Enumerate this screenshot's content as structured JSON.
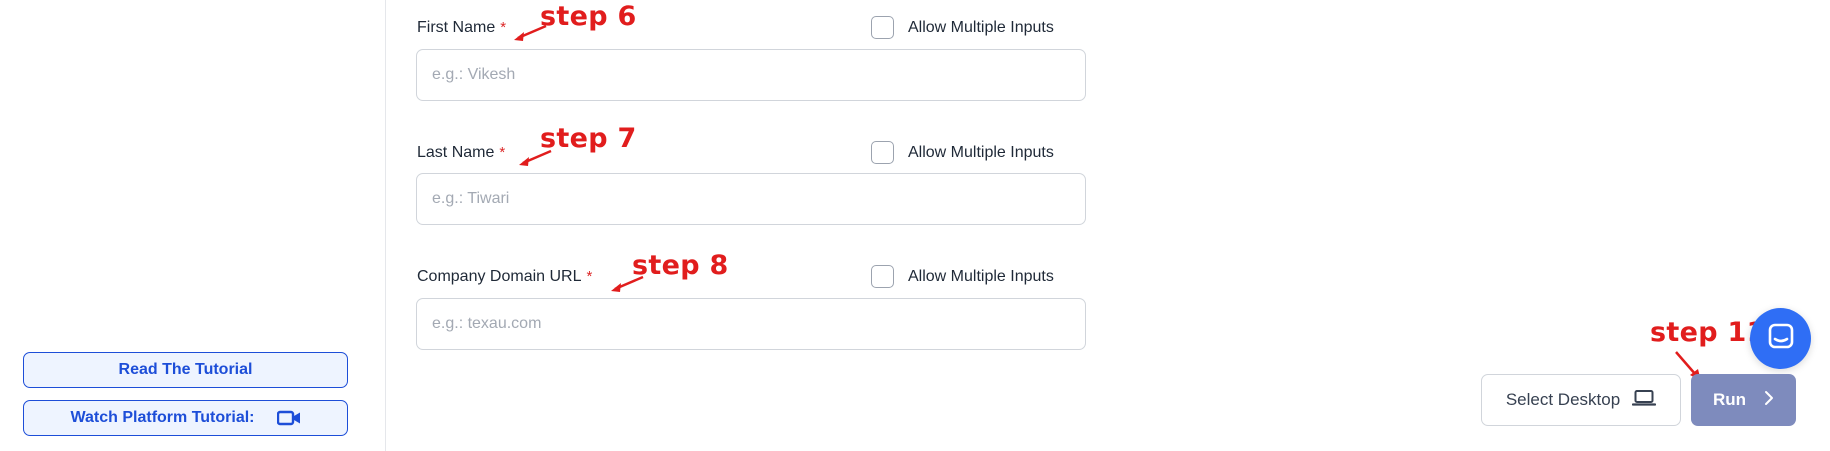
{
  "sidebar": {
    "read_tutorial": "Read The Tutorial",
    "watch_tutorial": "Watch Platform Tutorial:"
  },
  "form": {
    "allow_multiple_label": "Allow Multiple Inputs",
    "required_marker": "*",
    "fields": [
      {
        "label": "First Name",
        "placeholder": "e.g.: Vikesh",
        "value": ""
      },
      {
        "label": "Last Name",
        "placeholder": "e.g.: Tiwari",
        "value": ""
      },
      {
        "label": "Company Domain URL",
        "placeholder": "e.g.: texau.com",
        "value": ""
      }
    ]
  },
  "annotations": {
    "step6": "step 6",
    "step7": "step 7",
    "step8": "step 8",
    "step11": "step 11"
  },
  "actions": {
    "select_desktop": "Select Desktop",
    "run": "Run"
  },
  "icons": {
    "video": "video-camera-icon",
    "laptop": "laptop-icon",
    "chevron": "chevron-right-icon",
    "chat": "chat-bubble-icon"
  },
  "colors": {
    "accent": "#1d4ed8",
    "annotation": "#e11d1d",
    "run_button": "#7e8bbd",
    "chat_fab": "#2f6ef5"
  }
}
